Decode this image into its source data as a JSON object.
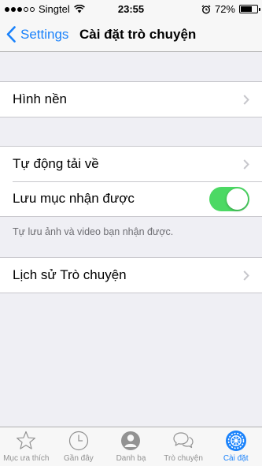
{
  "status_bar": {
    "carrier": "Singtel",
    "time": "23:55",
    "battery": "72%",
    "battery_level": 0.72,
    "signal_bars_filled": 3,
    "signal_bars_total": 5
  },
  "nav": {
    "back_label": "Settings",
    "title": "Cài đặt trò chuyện"
  },
  "groups": {
    "wallpaper": {
      "label": "Hình nền"
    },
    "media": {
      "auto_download_label": "Tự động tải về",
      "save_incoming_label": "Lưu mục nhận được",
      "save_incoming_on": true,
      "footer": "Tự lưu ảnh và video bạn nhận được."
    },
    "history": {
      "label": "Lịch sử Trò chuyện"
    }
  },
  "tab_bar": {
    "items": [
      {
        "label": "Mục ưa thích",
        "icon": "star-icon",
        "active": false
      },
      {
        "label": "Gần đây",
        "icon": "clock-icon",
        "active": false
      },
      {
        "label": "Danh bạ",
        "icon": "contacts-icon",
        "active": false
      },
      {
        "label": "Trò chuyện",
        "icon": "chats-icon",
        "active": false
      },
      {
        "label": "Cài đặt",
        "icon": "gear-icon",
        "active": true
      }
    ]
  },
  "colors": {
    "accent": "#1a82fb",
    "toggle_on": "#4cd964",
    "background": "#efeff4",
    "inactive_tab": "#929292"
  }
}
